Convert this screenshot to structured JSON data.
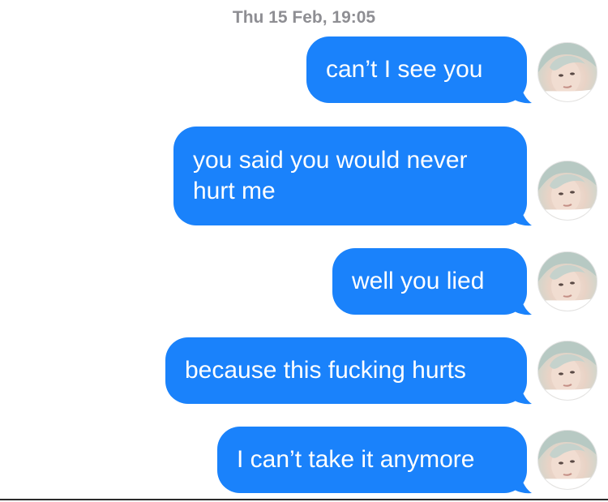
{
  "conversation": {
    "timestamp": "Thu 15 Feb, 19:05",
    "messages": [
      {
        "text": "can’t I see you"
      },
      {
        "text": "you said you would never\nhurt me"
      },
      {
        "text": "well you lied"
      },
      {
        "text": "because this fucking hurts"
      },
      {
        "text": "I can’t take it anymore"
      }
    ]
  },
  "colors": {
    "bubble": "#1a82fb",
    "bubble_text": "#ffffff",
    "timestamp": "#8e8e93"
  },
  "icons": {
    "avatar": "contact-photo"
  }
}
